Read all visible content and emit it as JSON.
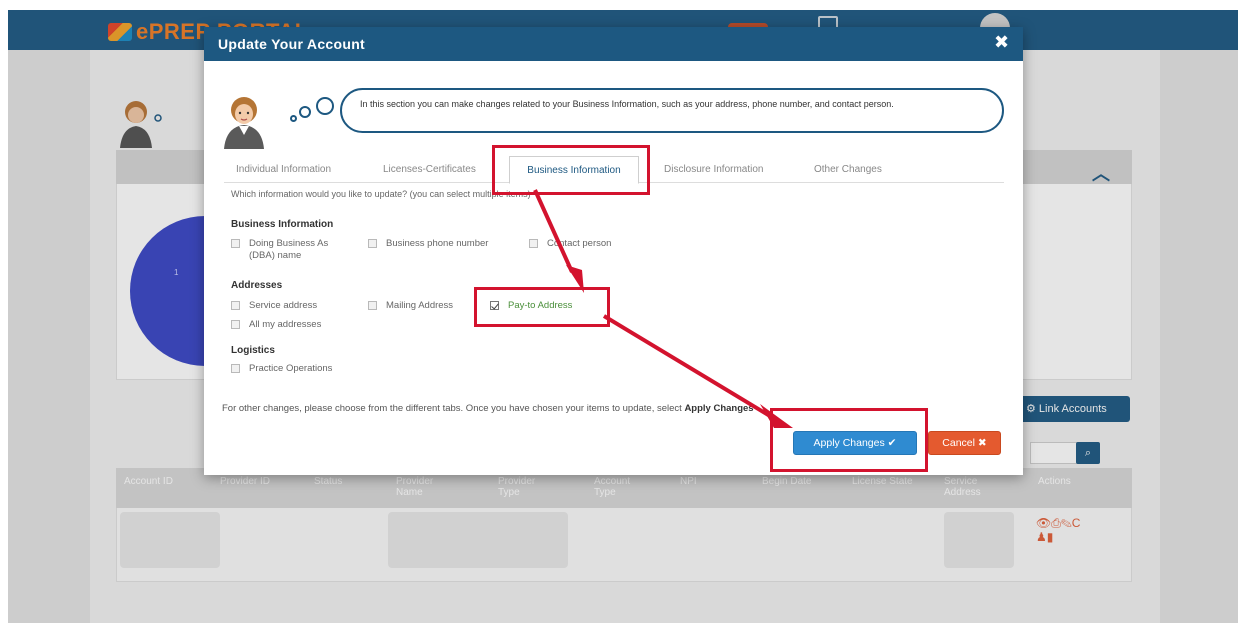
{
  "background": {
    "logo_text": "ePREP PORTAL",
    "pie_label": "1",
    "link_accounts_label": "Link Accounts",
    "table_headers": [
      "Account ID",
      "Provider ID",
      "Status",
      "Provider Name",
      "Provider Type",
      "Account Type",
      "NPI",
      "Begin Date",
      "License State",
      "Service Address",
      "Actions"
    ]
  },
  "modal": {
    "title": "Update Your Account",
    "close_icon": "close-icon",
    "assistant_message": "In this section you can make changes related to your Business Information, such as your address, phone number, and contact person.",
    "tabs": [
      {
        "label": "Individual Information",
        "active": false
      },
      {
        "label": "Licenses-Certificates",
        "active": false
      },
      {
        "label": "Business Information",
        "active": true
      },
      {
        "label": "Disclosure Information",
        "active": false
      },
      {
        "label": "Other Changes",
        "active": false
      }
    ],
    "question": "Which information would you like to update? (you can select multiple items)",
    "sections": {
      "business": {
        "title": "Business Information",
        "items": [
          {
            "label": "Doing Business As (DBA) name",
            "checked": false
          },
          {
            "label": "Business phone number",
            "checked": false
          },
          {
            "label": "Contact person",
            "checked": false
          }
        ]
      },
      "addresses": {
        "title": "Addresses",
        "items": [
          {
            "label": "Service address",
            "checked": false
          },
          {
            "label": "Mailing Address",
            "checked": false
          },
          {
            "label": "Pay-to Address",
            "checked": true
          },
          {
            "label": "All my addresses",
            "checked": false
          }
        ]
      },
      "logistics": {
        "title": "Logistics",
        "items": [
          {
            "label": "Practice Operations",
            "checked": false
          }
        ]
      }
    },
    "footer_note_pre": "For other changes, please choose from the different tabs. Once you have chosen your items to update, select ",
    "footer_note_hl": "Apply Changes",
    "apply_label": "Apply Changes",
    "cancel_label": "Cancel"
  },
  "colors": {
    "header_blue": "#1d5881",
    "apply_blue": "#2f8bd1",
    "cancel_orange": "#e45a2f",
    "highlight_red": "#d3132e",
    "checked_green": "#4a8f3a"
  }
}
